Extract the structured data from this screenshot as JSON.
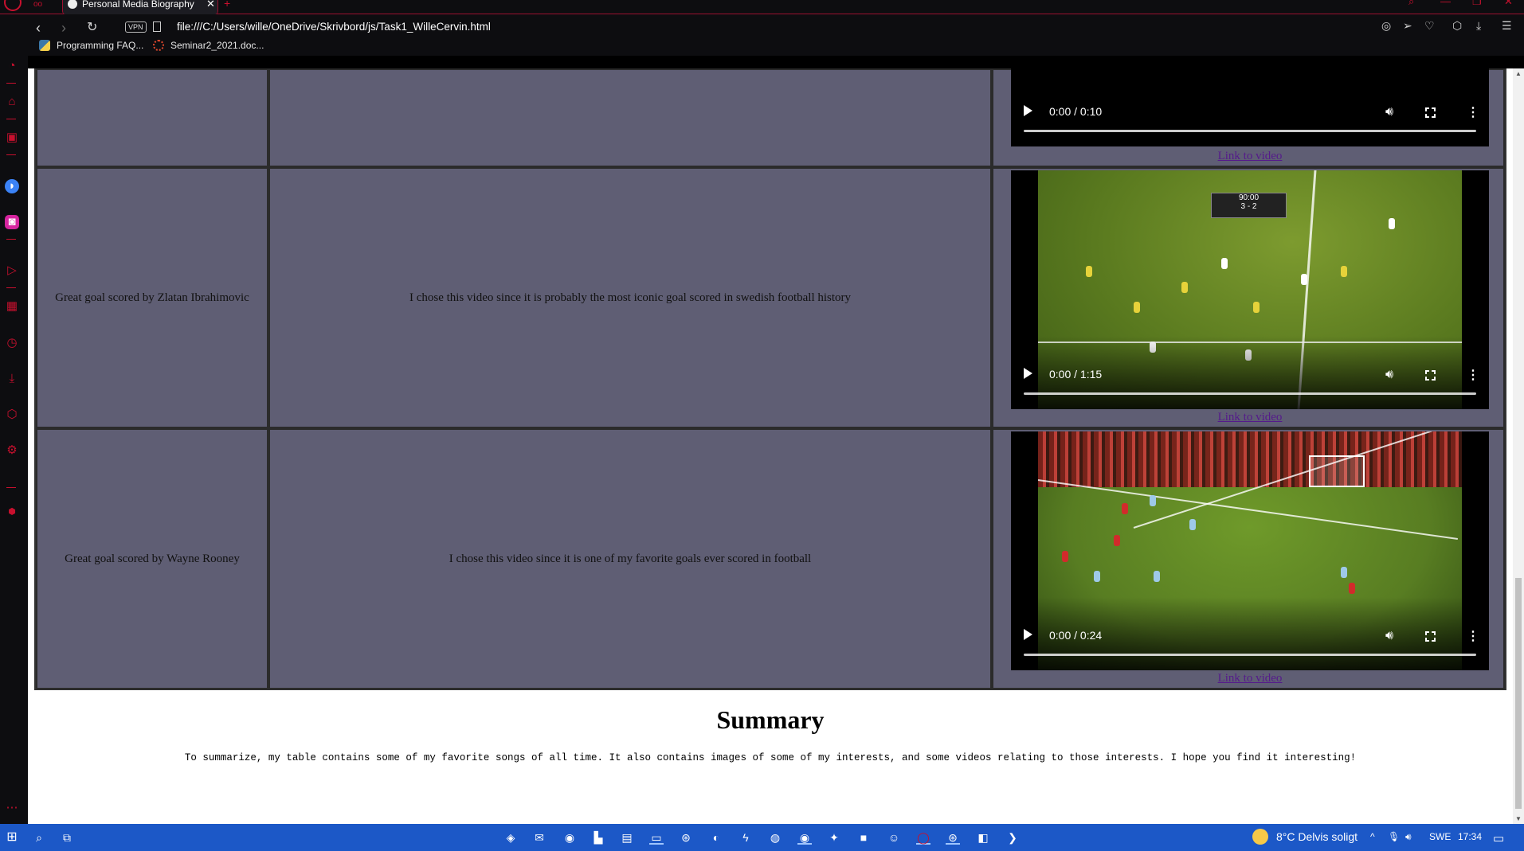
{
  "browser": {
    "tab_title": "Personal Media Biography",
    "url": "file:///C:/Users/wille/OneDrive/Skrivbord/js/Task1_WilleCervin.html",
    "vpn_label": "VPN",
    "bookmarks": [
      {
        "label": "Programming FAQ..."
      },
      {
        "label": "Seminar2_2021.doc..."
      }
    ]
  },
  "rows": [
    {
      "title": "",
      "description": "",
      "video_time": "0:00 / 0:10",
      "link": "Link to video"
    },
    {
      "title": "Great goal scored by Zlatan Ibrahimovic",
      "description": "I chose this video since it is probably the most iconic goal scored in swedish football history",
      "video_time": "0:00 / 1:15",
      "scoreboard": "90:00",
      "score": "3 - 2",
      "link": "Link to video"
    },
    {
      "title": "Great goal scored by Wayne Rooney",
      "description": "I chose this video since it is one of my favorite goals ever scored in football",
      "video_time": "0:00 / 0:24",
      "link": "Link to video"
    }
  ],
  "summary": {
    "heading": "Summary",
    "text": "To summarize, my table contains some of my favorite songs of all time. It also contains images of some of my interests, and some videos relating to those interests. I hope you find it interesting!"
  },
  "taskbar": {
    "weather": "8°C  Delvis soligt",
    "language": "SWE",
    "clock": "17:34"
  },
  "colors": {
    "table_cell": "#5f5e74",
    "opera_red": "#c8102e",
    "taskbar": "#1c58c7",
    "link": "#551a8b"
  }
}
